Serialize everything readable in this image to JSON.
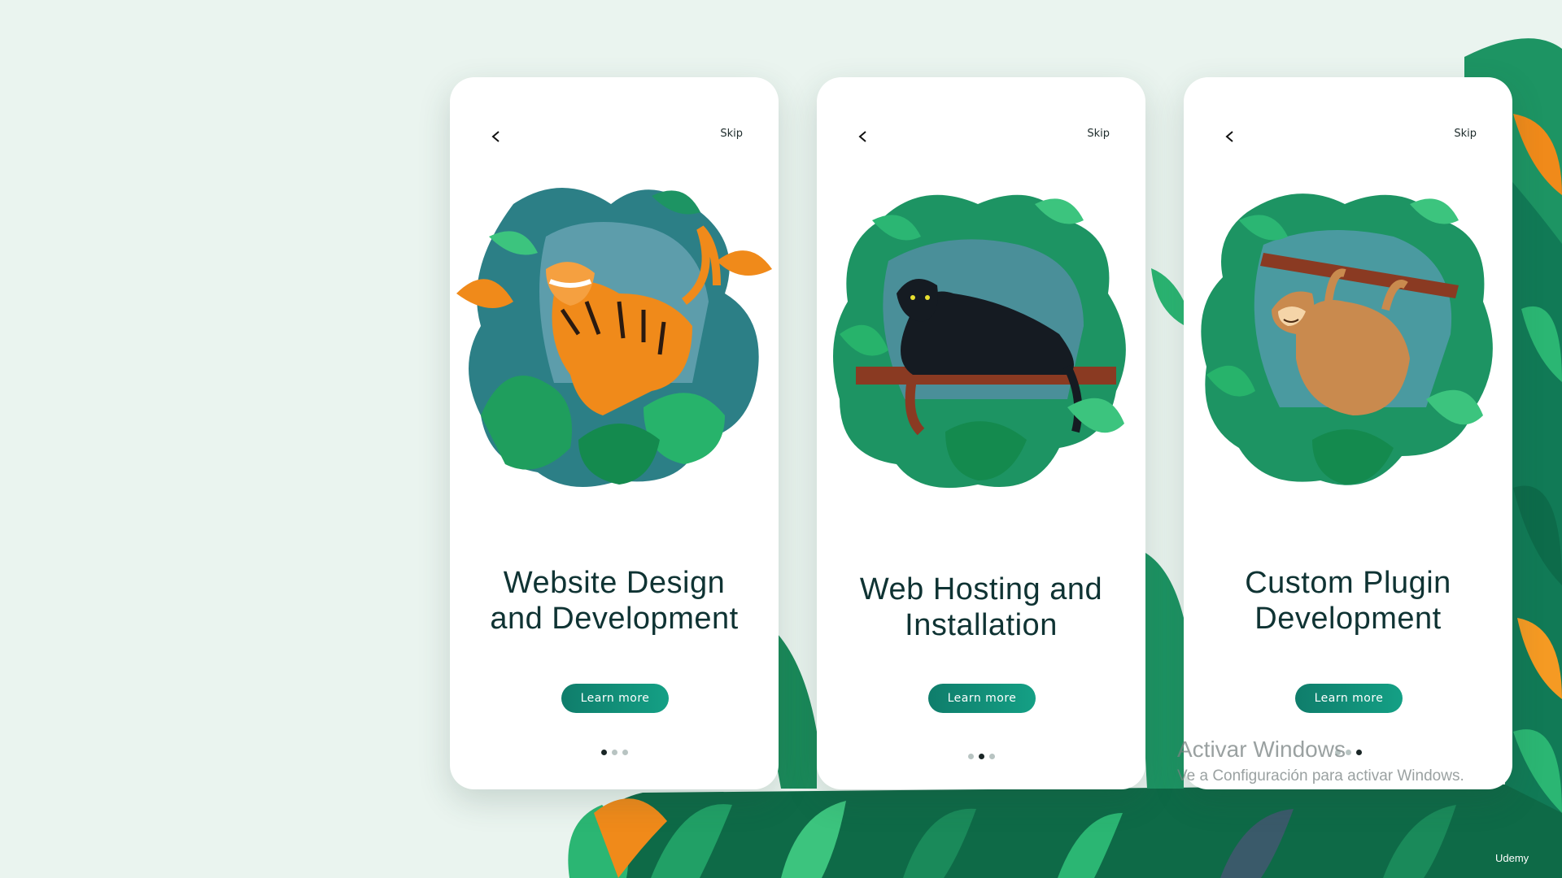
{
  "cards": [
    {
      "back_icon": "chevron-left-icon",
      "skip_label": "Skip",
      "illustration": "tiger-jungle-illustration",
      "title_line1": "Website Design",
      "title_line2": "and Development",
      "button_label": "Learn more",
      "pagination": {
        "total": 3,
        "active": 1
      }
    },
    {
      "back_icon": "chevron-left-icon",
      "skip_label": "Skip",
      "illustration": "panther-jungle-illustration",
      "title_line1": "Web Hosting and",
      "title_line2": "Installation",
      "button_label": "Learn more",
      "pagination": {
        "total": 3,
        "active": 2
      }
    },
    {
      "back_icon": "chevron-left-icon",
      "skip_label": "Skip",
      "illustration": "sloth-jungle-illustration",
      "title_line1": "Custom Plugin",
      "title_line2": "Development",
      "button_label": "Learn more",
      "pagination": {
        "total": 3,
        "active": 3
      }
    }
  ],
  "watermark": {
    "title": "Activar Windows",
    "subtitle": "Ve a Configuración para activar Windows."
  },
  "brand": "Udemy",
  "colors": {
    "background": "#eaf4ef",
    "accent": "#14a085",
    "title": "#0f3333",
    "dot_active": "#1a2626",
    "dot_inactive": "#b8c4c2"
  }
}
